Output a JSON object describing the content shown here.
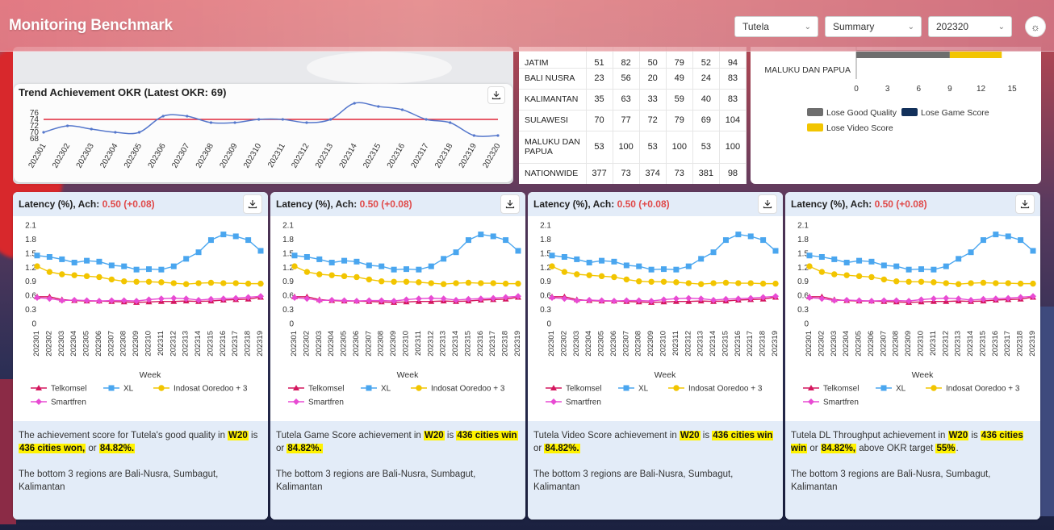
{
  "app": {
    "title": "Monitoring Benchmark"
  },
  "filters": {
    "operator": "Tutela",
    "view": "Summary",
    "period": "202320"
  },
  "trend": {
    "title": "Trend Achievement OKR (Latest OKR: 69)",
    "chart_data": {
      "type": "line",
      "x": [
        "202301",
        "202302",
        "202303",
        "202304",
        "202305",
        "202306",
        "202307",
        "202308",
        "202309",
        "202310",
        "202311",
        "202312",
        "202313",
        "202314",
        "202315",
        "202316",
        "202317",
        "202318",
        "202319",
        "202320"
      ],
      "series": [
        {
          "name": "",
          "values": [
            70,
            72,
            71,
            70,
            70,
            75,
            75,
            73,
            73,
            74,
            74,
            73,
            74,
            79,
            78,
            77,
            74,
            73,
            69,
            69
          ]
        }
      ],
      "target": 74,
      "yticks": [
        68,
        70,
        72,
        74,
        76
      ],
      "ylim": [
        68,
        76
      ]
    }
  },
  "region_table": {
    "rows": [
      {
        "region": "JATIM",
        "c1": "51",
        "c2": "82",
        "c3": "50",
        "c4": "79",
        "c5": "52",
        "c6": "94"
      },
      {
        "region": "BALI NUSRA",
        "c1": "23",
        "c2": "56",
        "c3": "20",
        "c4": "49",
        "c5": "24",
        "c6": "83"
      },
      {
        "region": "KALIMANTAN",
        "c1": "35",
        "c2": "63",
        "c3": "33",
        "c4": "59",
        "c5": "40",
        "c6": "83"
      },
      {
        "region": "SULAWESI",
        "c1": "70",
        "c2": "77",
        "c3": "72",
        "c4": "79",
        "c5": "69",
        "c6": "104"
      },
      {
        "region": "MALUKU DAN PAPUA",
        "c1": "53",
        "c2": "100",
        "c3": "53",
        "c4": "100",
        "c5": "53",
        "c6": "100"
      },
      {
        "region": "NATIONWIDE",
        "c1": "377",
        "c2": "73",
        "c3": "374",
        "c4": "73",
        "c5": "381",
        "c6": "98"
      }
    ]
  },
  "lose_chart": {
    "chart_data": {
      "type": "bar",
      "categories": [
        "MALUKU DAN PAPUA"
      ],
      "series": [
        {
          "name": "Lose Good Quality",
          "values": [
            9
          ]
        },
        {
          "name": "Lose Game Score",
          "values": [
            0
          ]
        },
        {
          "name": "Lose Video Score",
          "values": [
            5
          ]
        }
      ],
      "xticks": [
        0,
        3,
        6,
        9,
        12,
        15
      ],
      "xlim": [
        0,
        16
      ]
    },
    "legend": [
      "Lose Good Quality",
      "Lose Game Score",
      "Lose Video Score"
    ],
    "colors": [
      "#6e6e6e",
      "#12305a",
      "#f2c500"
    ]
  },
  "latency": {
    "chart_data": {
      "type": "line",
      "x": [
        "202301",
        "202302",
        "202303",
        "202304",
        "202305",
        "202306",
        "202307",
        "202308",
        "202309",
        "202310",
        "202311",
        "202312",
        "202313",
        "202314",
        "202315",
        "202316",
        "202317",
        "202318",
        "202319"
      ],
      "xlabel": "Week",
      "ylim": [
        0,
        2.1
      ],
      "yticks": [
        "0",
        "0.3",
        "0.6",
        "0.9",
        "1.2",
        "1.5",
        "1.8",
        "2.1"
      ],
      "series": [
        {
          "name": "Telkomsel",
          "color": "#d4175e",
          "values": [
            0.57,
            0.57,
            0.51,
            0.49,
            0.48,
            0.48,
            0.47,
            0.46,
            0.45,
            0.46,
            0.47,
            0.47,
            0.48,
            0.47,
            0.48,
            0.5,
            0.51,
            0.52,
            0.56
          ]
        },
        {
          "name": "XL",
          "color": "#4aa6ef",
          "values": [
            1.45,
            1.42,
            1.37,
            1.3,
            1.34,
            1.32,
            1.24,
            1.22,
            1.15,
            1.16,
            1.15,
            1.22,
            1.38,
            1.52,
            1.78,
            1.9,
            1.86,
            1.78,
            1.55
          ]
        },
        {
          "name": "Indosat Ooredoo + 3",
          "color": "#f2c500",
          "values": [
            1.22,
            1.1,
            1.05,
            1.03,
            1.01,
            0.99,
            0.94,
            0.9,
            0.89,
            0.89,
            0.88,
            0.86,
            0.84,
            0.86,
            0.87,
            0.86,
            0.86,
            0.85,
            0.85
          ]
        },
        {
          "name": "Smartfren",
          "color": "#e84bd3",
          "values": [
            0.55,
            0.53,
            0.49,
            0.5,
            0.49,
            0.48,
            0.49,
            0.49,
            0.48,
            0.51,
            0.53,
            0.54,
            0.53,
            0.5,
            0.52,
            0.53,
            0.54,
            0.56,
            0.58
          ]
        }
      ]
    },
    "cards": [
      {
        "title": "Latency (%), Ach: ",
        "ach": "0.50 (+0.08)",
        "sum": [
          {
            "t": "The achievement score for Tutela's good quality in "
          },
          {
            "t": "W20",
            "h": 1
          },
          {
            "t": " is "
          },
          {
            "t": "436 cities won,",
            "h": 1
          },
          {
            "t": " or "
          },
          {
            "t": "84.82%.",
            "h": 1
          }
        ],
        "bottom": "The bottom 3 regions are Bali-Nusra, Sumbagut, Kalimantan"
      },
      {
        "title": "Latency (%), Ach: ",
        "ach": "0.50 (+0.08)",
        "sum": [
          {
            "t": "Tutela Game Score achievement in "
          },
          {
            "t": "W20",
            "h": 1
          },
          {
            "t": " is "
          },
          {
            "t": "436 cities win",
            "h": 1
          },
          {
            "t": " or "
          },
          {
            "t": "84.82%.",
            "h": 1
          }
        ],
        "bottom": "The bottom 3 regions are Bali-Nusra, Sumbagut, Kalimantan"
      },
      {
        "title": "Latency (%), Ach: ",
        "ach": "0.50 (+0.08)",
        "sum": [
          {
            "t": "Tutela Video Score achievement in "
          },
          {
            "t": "W20",
            "h": 1
          },
          {
            "t": " is "
          },
          {
            "t": "436 cities win",
            "h": 1
          },
          {
            "t": " or "
          },
          {
            "t": "84.82%.",
            "h": 1
          }
        ],
        "bottom": "The bottom 3 regions are Bali-Nusra, Sumbagut, Kalimantan"
      },
      {
        "title": "Latency (%), Ach: ",
        "ach": "0.50 (+0.08)",
        "sum": [
          {
            "t": "Tutela DL Throughput achievement in "
          },
          {
            "t": "W20",
            "h": 1
          },
          {
            "t": " is "
          },
          {
            "t": "436 cities win",
            "h": 1
          },
          {
            "t": " or "
          },
          {
            "t": "84.82%,",
            "h": 1
          },
          {
            "t": " above OKR target "
          },
          {
            "t": "55%",
            "h": 1
          },
          {
            "t": "."
          }
        ],
        "bottom": "The bottom 3 regions are Bali-Nusra, Sumbagut, Kalimantan"
      }
    ]
  },
  "icons": {
    "download": "download-icon",
    "theme": "sun-icon",
    "chevron": "chevron-down-icon"
  }
}
